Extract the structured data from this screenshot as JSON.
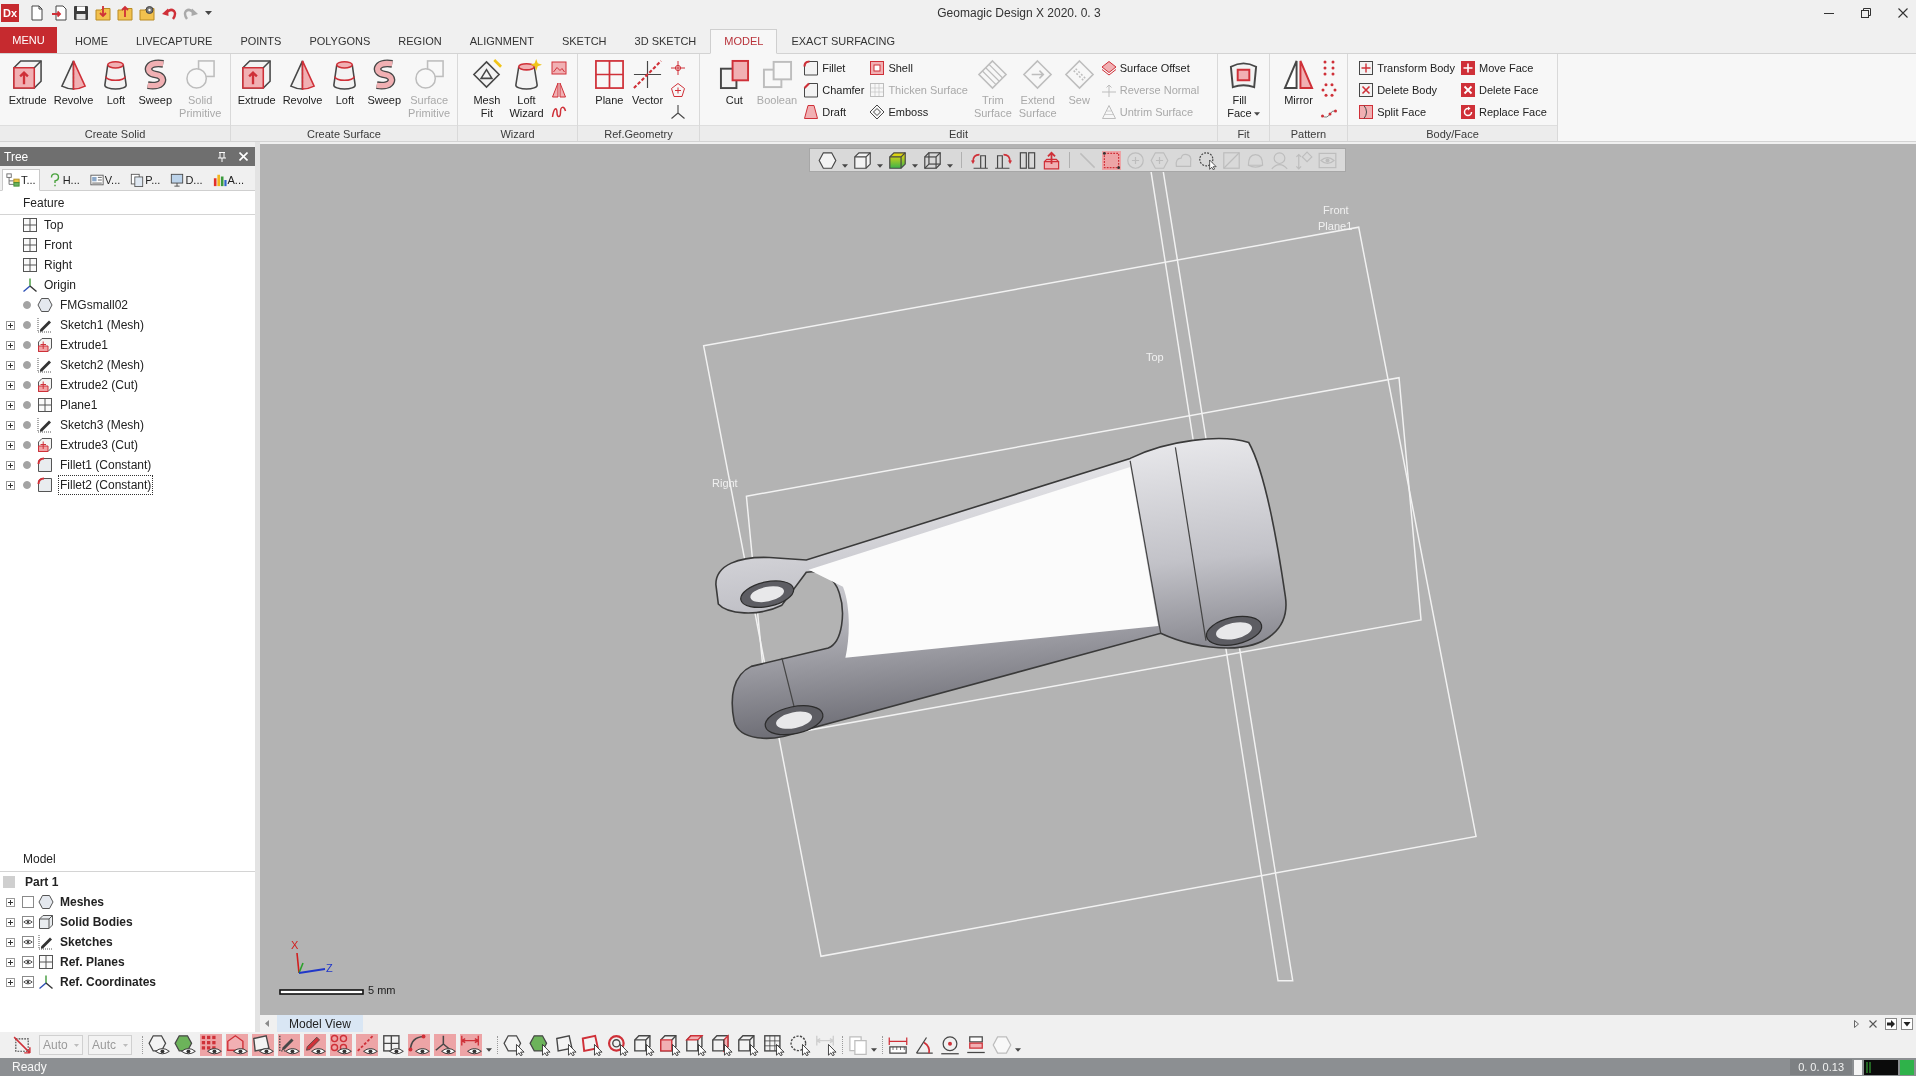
{
  "title_bar": {
    "logo": "Dx",
    "title": "Geomagic Design X 2020. 0. 3"
  },
  "ribbon_tabs": [
    {
      "label": "MENU",
      "kind": "menu",
      "selected": false
    },
    {
      "label": "HOME",
      "kind": "tab",
      "selected": false
    },
    {
      "label": "LIVECAPTURE",
      "kind": "tab",
      "selected": false
    },
    {
      "label": "POINTS",
      "kind": "tab",
      "selected": false
    },
    {
      "label": "POLYGONS",
      "kind": "tab",
      "selected": false
    },
    {
      "label": "REGION",
      "kind": "tab",
      "selected": false
    },
    {
      "label": "ALIGNMENT",
      "kind": "tab",
      "selected": false
    },
    {
      "label": "SKETCH",
      "kind": "tab",
      "selected": false
    },
    {
      "label": "3D SKETCH",
      "kind": "tab",
      "selected": false
    },
    {
      "label": "MODEL",
      "kind": "tab",
      "selected": true
    },
    {
      "label": "EXACT SURFACING",
      "kind": "tab",
      "selected": false
    }
  ],
  "ribbon_groups": [
    {
      "label": "Create Solid",
      "items": [
        {
          "kind": "large",
          "label": "Extrude",
          "disabled": false
        },
        {
          "kind": "large",
          "label": "Revolve",
          "disabled": false
        },
        {
          "kind": "large",
          "label": "Loft",
          "disabled": false
        },
        {
          "kind": "large",
          "label": "Sweep",
          "disabled": false
        },
        {
          "kind": "large",
          "label": "Solid Primitive",
          "disabled": true
        }
      ]
    },
    {
      "label": "Create Surface",
      "items": [
        {
          "kind": "large",
          "label": "Extrude",
          "disabled": false
        },
        {
          "kind": "large",
          "label": "Revolve",
          "disabled": false
        },
        {
          "kind": "large",
          "label": "Loft",
          "disabled": false
        },
        {
          "kind": "large",
          "label": "Sweep",
          "disabled": false
        },
        {
          "kind": "large",
          "label": "Surface Primitive",
          "disabled": true
        }
      ]
    },
    {
      "label": "Wizard",
      "items": [
        {
          "kind": "large",
          "label": "Mesh Fit",
          "disabled": false
        },
        {
          "kind": "large",
          "label": "Loft Wizard",
          "disabled": false
        }
      ]
    },
    {
      "label": "Ref.Geometry",
      "items": [
        {
          "kind": "large",
          "label": "Plane",
          "disabled": false
        },
        {
          "kind": "large",
          "label": "Vector",
          "disabled": false
        }
      ]
    },
    {
      "label": "Edit",
      "items": [
        {
          "kind": "large",
          "label": "Cut",
          "disabled": false
        },
        {
          "kind": "large",
          "label": "Boolean",
          "disabled": true
        },
        {
          "kind": "column",
          "items": [
            {
              "label": "Fillet",
              "disabled": false
            },
            {
              "label": "Chamfer",
              "disabled": false
            },
            {
              "label": "Draft",
              "disabled": false
            }
          ]
        },
        {
          "kind": "column",
          "items": [
            {
              "label": "Shell",
              "disabled": false
            },
            {
              "label": "Thicken Surface",
              "disabled": true
            },
            {
              "label": "Emboss",
              "disabled": false
            }
          ]
        },
        {
          "kind": "large",
          "label": "Trim Surface",
          "disabled": true
        },
        {
          "kind": "large",
          "label": "Extend Surface",
          "disabled": true
        },
        {
          "kind": "large",
          "label": "Sew",
          "disabled": true
        },
        {
          "kind": "column",
          "items": [
            {
              "label": "Surface Offset",
              "disabled": false
            },
            {
              "label": "Reverse Normal",
              "disabled": true
            },
            {
              "label": "Untrim Surface",
              "disabled": true
            }
          ]
        }
      ]
    },
    {
      "label": "Fit",
      "items": [
        {
          "kind": "large",
          "label": "Fill Face",
          "disabled": false,
          "dropdown": true
        }
      ]
    },
    {
      "label": "Pattern",
      "items": [
        {
          "kind": "large",
          "label": "Mirror",
          "disabled": false
        }
      ]
    },
    {
      "label": "Body/Face",
      "items": [
        {
          "kind": "column",
          "items": [
            {
              "label": "Transform Body",
              "disabled": false
            },
            {
              "label": "Delete Body",
              "disabled": false
            },
            {
              "label": "Split Face",
              "disabled": false
            }
          ]
        },
        {
          "kind": "column",
          "items": [
            {
              "label": "Move Face",
              "disabled": false
            },
            {
              "label": "Delete Face",
              "disabled": false
            },
            {
              "label": "Replace Face",
              "disabled": false
            }
          ]
        }
      ]
    }
  ],
  "tree_panel": {
    "title": "Tree",
    "tabs": [
      {
        "label": "T...",
        "selected": true
      },
      {
        "label": "H...",
        "selected": false
      },
      {
        "label": "V...",
        "selected": false
      },
      {
        "label": "P...",
        "selected": false
      },
      {
        "label": "D...",
        "selected": false
      },
      {
        "label": "A...",
        "selected": false
      }
    ],
    "feature_header": "Feature",
    "features": [
      {
        "label": "Top",
        "kind": "plane",
        "focused": false
      },
      {
        "label": "Front",
        "kind": "plane",
        "focused": false
      },
      {
        "label": "Right",
        "kind": "plane",
        "focused": false
      },
      {
        "label": "Origin",
        "kind": "origin",
        "focused": false
      },
      {
        "label": "FMGsmall02",
        "kind": "mesh",
        "active": true,
        "focused": false
      },
      {
        "label": "Sketch1 (Mesh)",
        "kind": "sketch",
        "active": true,
        "expanded": false,
        "focused": false
      },
      {
        "label": "Extrude1",
        "kind": "extrude",
        "active": true,
        "expanded": false,
        "focused": false
      },
      {
        "label": "Sketch2 (Mesh)",
        "kind": "sketch",
        "active": true,
        "expanded": false,
        "focused": false
      },
      {
        "label": "Extrude2 (Cut)",
        "kind": "extrude",
        "active": true,
        "expanded": false,
        "focused": false
      },
      {
        "label": "Plane1",
        "kind": "plane",
        "active": true,
        "expanded": false,
        "focused": false
      },
      {
        "label": "Sketch3 (Mesh)",
        "kind": "sketch",
        "active": true,
        "expanded": false,
        "focused": false
      },
      {
        "label": "Extrude3 (Cut)",
        "kind": "extrude",
        "active": true,
        "expanded": false,
        "focused": false
      },
      {
        "label": "Fillet1 (Constant)",
        "kind": "fillet",
        "active": true,
        "expanded": false,
        "focused": false
      },
      {
        "label": "Fillet2 (Constant)",
        "kind": "fillet",
        "active": true,
        "expanded": false,
        "focused": true
      }
    ],
    "model_header": "Model",
    "part": "Part 1",
    "model_items": [
      {
        "label": "Meshes",
        "kind": "mesh",
        "visible": false,
        "expanded": false
      },
      {
        "label": "Solid Bodies",
        "kind": "solid",
        "visible": true,
        "expanded": false
      },
      {
        "label": "Sketches",
        "kind": "sketch",
        "visible": true,
        "expanded": false
      },
      {
        "label": "Ref. Planes",
        "kind": "plane",
        "visible": true,
        "expanded": false
      },
      {
        "label": "Ref. Coordinates",
        "kind": "origin",
        "visible": true,
        "expanded": false
      }
    ]
  },
  "viewport": {
    "toolbar": [
      {
        "on": false,
        "disabled": false
      },
      {
        "on": false,
        "disabled": false
      },
      {
        "on": false,
        "disabled": false
      },
      {
        "on": false,
        "disabled": false
      },
      {
        "on": false,
        "disabled": false
      },
      {
        "on": false,
        "disabled": false
      },
      {
        "on": false,
        "disabled": false
      },
      {
        "on": false,
        "disabled": false
      },
      {
        "on": false,
        "disabled": true
      },
      {
        "on": true,
        "disabled": false
      },
      {
        "on": false,
        "disabled": true
      },
      {
        "on": false,
        "disabled": true
      },
      {
        "on": false,
        "disabled": true
      },
      {
        "on": false,
        "disabled": false
      },
      {
        "on": false,
        "disabled": true
      },
      {
        "on": false,
        "disabled": true
      },
      {
        "on": false,
        "disabled": true
      },
      {
        "on": false,
        "disabled": true
      },
      {
        "on": false,
        "disabled": true
      }
    ],
    "plane_labels": [
      "Front",
      "Plane1",
      "Top",
      "Right"
    ],
    "axis_labels": [
      "X",
      "Z"
    ],
    "scale_label": "5 mm"
  },
  "view_tabs": [
    {
      "label": "Model View",
      "selected": true
    }
  ],
  "bottom_toolbar": {
    "dropdowns": [
      {
        "value": "Auto",
        "disabled": true
      },
      {
        "value": "Autc",
        "disabled": true
      }
    ],
    "display_toggles": [
      {
        "on": false
      },
      {
        "on": false
      },
      {
        "on": true
      },
      {
        "on": true
      },
      {
        "on": true
      },
      {
        "on": true
      },
      {
        "on": true
      },
      {
        "on": true
      },
      {
        "on": true
      },
      {
        "on": false
      },
      {
        "on": true
      },
      {
        "on": true
      },
      {
        "on": true
      }
    ],
    "select_tools": [
      {
        "disabled": false
      },
      {
        "disabled": false
      },
      {
        "disabled": false
      },
      {
        "disabled": false
      },
      {
        "disabled": false
      },
      {
        "disabled": false
      },
      {
        "disabled": false
      },
      {
        "disabled": false
      },
      {
        "disabled": false
      },
      {
        "disabled": false
      },
      {
        "disabled": false
      },
      {
        "disabled": false
      },
      {
        "disabled": true
      }
    ],
    "document_tool": {
      "disabled": true
    },
    "measure_tools": [
      {
        "disabled": false
      },
      {
        "disabled": false
      },
      {
        "disabled": false
      },
      {
        "disabled": false
      },
      {
        "disabled": true
      }
    ]
  },
  "status_bar": {
    "message": "Ready",
    "readout": "0. 0. 0.13"
  }
}
